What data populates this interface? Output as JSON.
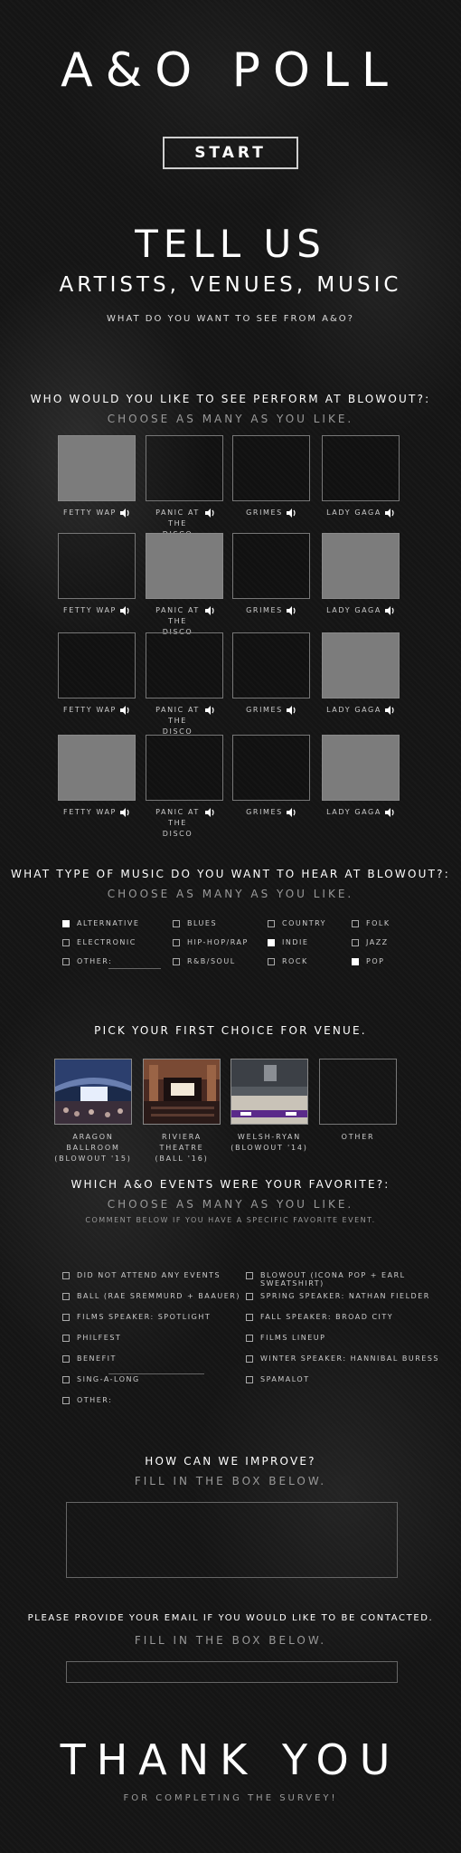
{
  "header": {
    "title": "A&O POLL",
    "start_label": "START"
  },
  "intro": {
    "heading": "TELL US",
    "subheading": "ARTISTS, VENUES, MUSIC",
    "question": "WHAT DO YOU WANT TO SEE FROM A&O?"
  },
  "performers": {
    "question": "WHO WOULD YOU LIKE TO SEE PERFORM AT BLOWOUT?:",
    "instruction": "CHOOSE AS MANY AS YOU LIKE.",
    "rows": [
      [
        {
          "label": "FETTY WAP",
          "selected": true
        },
        {
          "label": "PANIC AT THE DISCO",
          "selected": false
        },
        {
          "label": "GRIMES",
          "selected": false
        },
        {
          "label": "LADY GAGA",
          "selected": false
        }
      ],
      [
        {
          "label": "FETTY WAP",
          "selected": false
        },
        {
          "label": "PANIC AT THE DISCO",
          "selected": true
        },
        {
          "label": "GRIMES",
          "selected": false
        },
        {
          "label": "LADY GAGA",
          "selected": true
        }
      ],
      [
        {
          "label": "FETTY WAP",
          "selected": false
        },
        {
          "label": "PANIC AT THE DISCO",
          "selected": false
        },
        {
          "label": "GRIMES",
          "selected": false
        },
        {
          "label": "LADY GAGA",
          "selected": true
        }
      ],
      [
        {
          "label": "FETTY WAP",
          "selected": true
        },
        {
          "label": "PANIC AT THE DISCO",
          "selected": false
        },
        {
          "label": "GRIMES",
          "selected": false
        },
        {
          "label": "LADY GAGA",
          "selected": true
        }
      ]
    ]
  },
  "music": {
    "question": "WHAT TYPE OF MUSIC DO YOU WANT TO HEAR AT BLOWOUT?:",
    "instruction": "CHOOSE AS MANY AS YOU LIKE.",
    "options": [
      {
        "label": "ALTERNATIVE",
        "checked": true
      },
      {
        "label": "BLUES",
        "checked": false
      },
      {
        "label": "COUNTRY",
        "checked": false
      },
      {
        "label": "FOLK",
        "checked": false
      },
      {
        "label": "ELECTRONIC",
        "checked": false
      },
      {
        "label": "HIP-HOP/RAP",
        "checked": false
      },
      {
        "label": "INDIE",
        "checked": true
      },
      {
        "label": "JAZZ",
        "checked": false
      },
      {
        "label": "OTHER:",
        "checked": false
      },
      {
        "label": "R&B/SOUL",
        "checked": false
      },
      {
        "label": "ROCK",
        "checked": false
      },
      {
        "label": "POP",
        "checked": true
      }
    ]
  },
  "venue": {
    "question": "PICK YOUR FIRST CHOICE FOR VENUE.",
    "options": [
      {
        "line1": "ARAGON",
        "line2": "BALLROOM",
        "line3": "(BLOWOUT '15)"
      },
      {
        "line1": "RIVIERA",
        "line2": "THEATRE",
        "line3": "(BALL '16)"
      },
      {
        "line1": "WELSH-RYAN",
        "line2": "(BLOWOUT '14)",
        "line3": ""
      },
      {
        "line1": "OTHER",
        "line2": "",
        "line3": ""
      }
    ]
  },
  "events": {
    "question": "WHICH A&O EVENTS WERE YOUR FAVORITE?:",
    "instruction": "CHOOSE AS MANY AS YOU LIKE.",
    "comment": "COMMENT BELOW IF YOU HAVE A SPECIFIC FAVORITE EVENT.",
    "left": [
      "DID NOT ATTEND ANY EVENTS",
      "BALL (RAE SREMMURD + BAAUER)",
      "FILMS SPEAKER: SPOTLIGHT",
      "PHILFEST",
      "BENEFIT",
      "SING-A-LONG",
      "OTHER:"
    ],
    "right": [
      "BLOWOUT (ICONA POP + EARL SWEATSHIRT)",
      "SPRING SPEAKER: NATHAN FIELDER",
      "FALL SPEAKER: BROAD CITY",
      "FILMS LINEUP",
      "WINTER SPEAKER: HANNIBAL BURESS",
      "SPAMALOT"
    ]
  },
  "improve": {
    "question": "HOW CAN WE IMPROVE?",
    "instruction": "FILL IN THE BOX BELOW.",
    "value": ""
  },
  "email": {
    "question": "PLEASE PROVIDE YOUR EMAIL IF YOU WOULD LIKE TO BE CONTACTED.",
    "instruction": "FILL IN THE BOX BELOW.",
    "value": ""
  },
  "footer": {
    "thanks": "THANK YOU",
    "subtitle": "FOR COMPLETING THE SURVEY!"
  },
  "colors": {
    "tile_selected": "#7c7c7c",
    "background": "#151515",
    "text": "#ffffff"
  }
}
